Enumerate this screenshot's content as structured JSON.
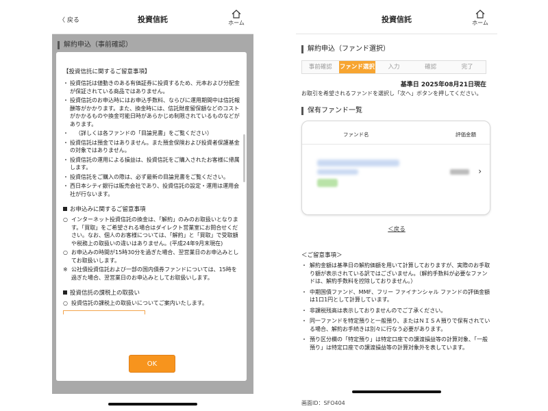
{
  "left": {
    "back_label": "戻る",
    "title": "投資信託",
    "home_label": "ホーム",
    "under_title": "解約申込（事前確認）",
    "section1_title": "【投資信託に関するご留意事項】",
    "section1_items": [
      "投資信託は値動きのある有価証券に投資するため、元本および分配金が保証されている商品ではありません。",
      "投資信託のお申込時にはお申込手数料、ならびに運用期間中は信託報酬等がかかります。また、換金時には、信託財産留保額などのコストがかかるものや換金可能日時があらかじめ制限されているものなどがあります。",
      "（詳しくは各ファンドの「目論見書」をご覧ください）",
      "投資信託は預金ではありません。また預金保険および投資者保護基金の対象ではありません。",
      "投資信託の運用による損益は、投資信託をご購入されたお客様に帰属します。",
      "投資信託をご購入の際は、必ず最新の目論見書をご覧ください。",
      "西日本シティ銀行は販売会社であり、投資信託の設定・運用は運用会社が行ないます。"
    ],
    "section2_title": "お申込みに関するご留意事項",
    "section2_items": [
      "インターネット投資信託の換金は、「解約」のみのお取扱いとなります。「買取」をご希望される場合はダイレクト営業室にお問合せください。なお、個人のお客様については、「解約」と「買取」で受取額や税務上の取扱いの違いはありません。(平成24年9月末現在)",
      "お申込みの時間が15時30分を過ぎた場合、翌営業日のお申込みとしてお取扱いします。"
    ],
    "section2_note_mark": "※",
    "section2_note": "公社債投資信託および一部の国内債券ファンドについては、15時を過ぎた場合、翌営業日のお申込みとしてお取扱いします。",
    "section3_title": "投資信託の課税上の取扱い",
    "section3_items": [
      "投資信託の課税上の取扱いについてご案内いたします。"
    ],
    "ok_label": "OK"
  },
  "right": {
    "title": "投資信託",
    "home_label": "ホーム",
    "section_title": "解約申込（ファンド選択）",
    "steps": [
      {
        "label": "事前確認",
        "active": false
      },
      {
        "label": "ファンド選択",
        "active": true
      },
      {
        "label": "入力",
        "active": false
      },
      {
        "label": "確認",
        "active": false
      },
      {
        "label": "完了",
        "active": false
      }
    ],
    "base_date": "基準日 2025年08月21日現在",
    "instruction": "お取引を希望されるファンドを選択し「次へ」ボタンを押してください。",
    "holdings_title": "保有ファンド一覧",
    "col_fund_name": "ファンド名",
    "col_value": "評価金額",
    "back_link": "＜戻る",
    "caution_title": "＜ご留意事項＞",
    "caution_items": [
      "解約金額は基準日の解約価額を用いて計算しておりますが、実際のお手取り額が表示されている訳ではございません。（解約手数料が必要なファンドは、解約手数料を控除しておりません。）",
      "中期国債ファンド、MMF、フリー ファイナンシャル ファンドの評価金額は1口1円として計算しています。",
      "非課税残高は表示しておりませんのでご了承ください。",
      "同一ファンドを特定預りと一般預り、またはＮＩＳＡ預りで保有されている場合、解約お手続きは別々に行なう必要があります。",
      "預り区分欄の「特定預り」は特定口座での譲渡損益等の計算対象、「一般預り」は特定口座での譲渡損益等の計算対象外を表しています。"
    ],
    "screen_id": "画面ID：SFO404"
  },
  "colors": {
    "accent": "#f7941d",
    "active_step": "#f7a531",
    "overlay": "#a9a9a9"
  }
}
